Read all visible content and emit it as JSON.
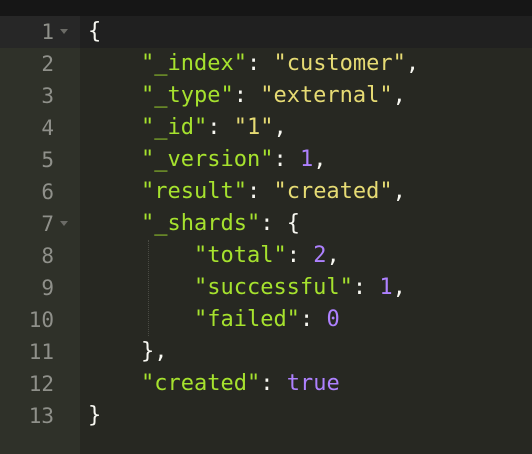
{
  "editor": {
    "lines": [
      {
        "num": "1",
        "fold": true
      },
      {
        "num": "2"
      },
      {
        "num": "3"
      },
      {
        "num": "4"
      },
      {
        "num": "5"
      },
      {
        "num": "6"
      },
      {
        "num": "7",
        "fold": true
      },
      {
        "num": "8"
      },
      {
        "num": "9"
      },
      {
        "num": "10"
      },
      {
        "num": "11"
      },
      {
        "num": "12"
      },
      {
        "num": "13"
      }
    ],
    "tokens": {
      "l1_open": "{",
      "l2_key": "\"_index\"",
      "l2_val": "\"customer\"",
      "l3_key": "\"_type\"",
      "l3_val": "\"external\"",
      "l4_key": "\"_id\"",
      "l4_val": "\"1\"",
      "l5_key": "\"_version\"",
      "l5_val": "1",
      "l6_key": "\"result\"",
      "l6_val": "\"created\"",
      "l7_key": "\"_shards\"",
      "l7_open": "{",
      "l8_key": "\"total\"",
      "l8_val": "2",
      "l9_key": "\"successful\"",
      "l9_val": "1",
      "l10_key": "\"failed\"",
      "l10_val": "0",
      "l11_close": "},",
      "l12_key": "\"created\"",
      "l12_val": "true",
      "l13_close": "}"
    },
    "colors": {
      "background": "#272822",
      "gutter": "#2f3129",
      "key": "#a6e22e",
      "string": "#e6db74",
      "number": "#ae81ff",
      "text": "#f8f8f2"
    }
  }
}
